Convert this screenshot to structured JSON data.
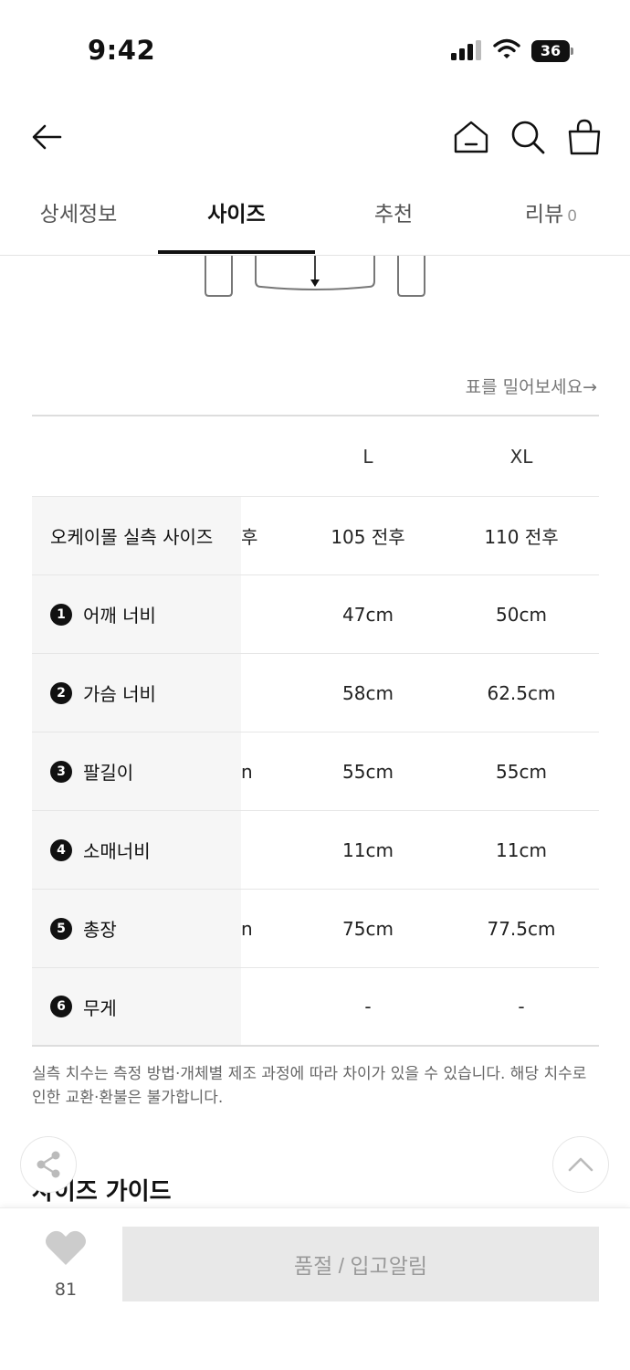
{
  "status_bar": {
    "time": "9:42",
    "battery": "36"
  },
  "tabs": [
    {
      "label": "상세정보"
    },
    {
      "label": "사이즈",
      "active": true
    },
    {
      "label": "추천"
    },
    {
      "label": "리뷰",
      "count": "0"
    }
  ],
  "table_hint": "표를 밀어보세요→",
  "size_table": {
    "columns": [
      "L",
      "XL"
    ],
    "rows": [
      {
        "label": "오케이몰 실측 사이즈",
        "partial": "후",
        "L": "105 전후",
        "XL": "110 전후"
      },
      {
        "num": "1",
        "label": "어깨 너비",
        "partial": "",
        "L": "47cm",
        "XL": "50cm"
      },
      {
        "num": "2",
        "label": "가슴 너비",
        "partial": "",
        "L": "58cm",
        "XL": "62.5cm"
      },
      {
        "num": "3",
        "label": "팔길이",
        "partial": "n",
        "L": "55cm",
        "XL": "55cm"
      },
      {
        "num": "4",
        "label": "소매너비",
        "partial": "",
        "L": "11cm",
        "XL": "11cm"
      },
      {
        "num": "5",
        "label": "총장",
        "partial": "n",
        "L": "75cm",
        "XL": "77.5cm"
      },
      {
        "num": "6",
        "label": "무게",
        "partial": "",
        "L": "-",
        "XL": "-"
      }
    ]
  },
  "notice": "실측 치수는 측정 방법·개체별 제조 과정에 따라 차이가 있을 수 있습니다. 해당 치수로 인한 교환·환불은 불가합니다.",
  "size_guide_title": "사이즈 가이드",
  "bottom_bar": {
    "like_count": "81",
    "button_label": "품절 / 입고알림"
  },
  "colors": {
    "active_tab": "#111111",
    "button_bg": "#e8e8e8",
    "button_text": "#9a9a9a",
    "label_bg": "#f6f6f6"
  }
}
